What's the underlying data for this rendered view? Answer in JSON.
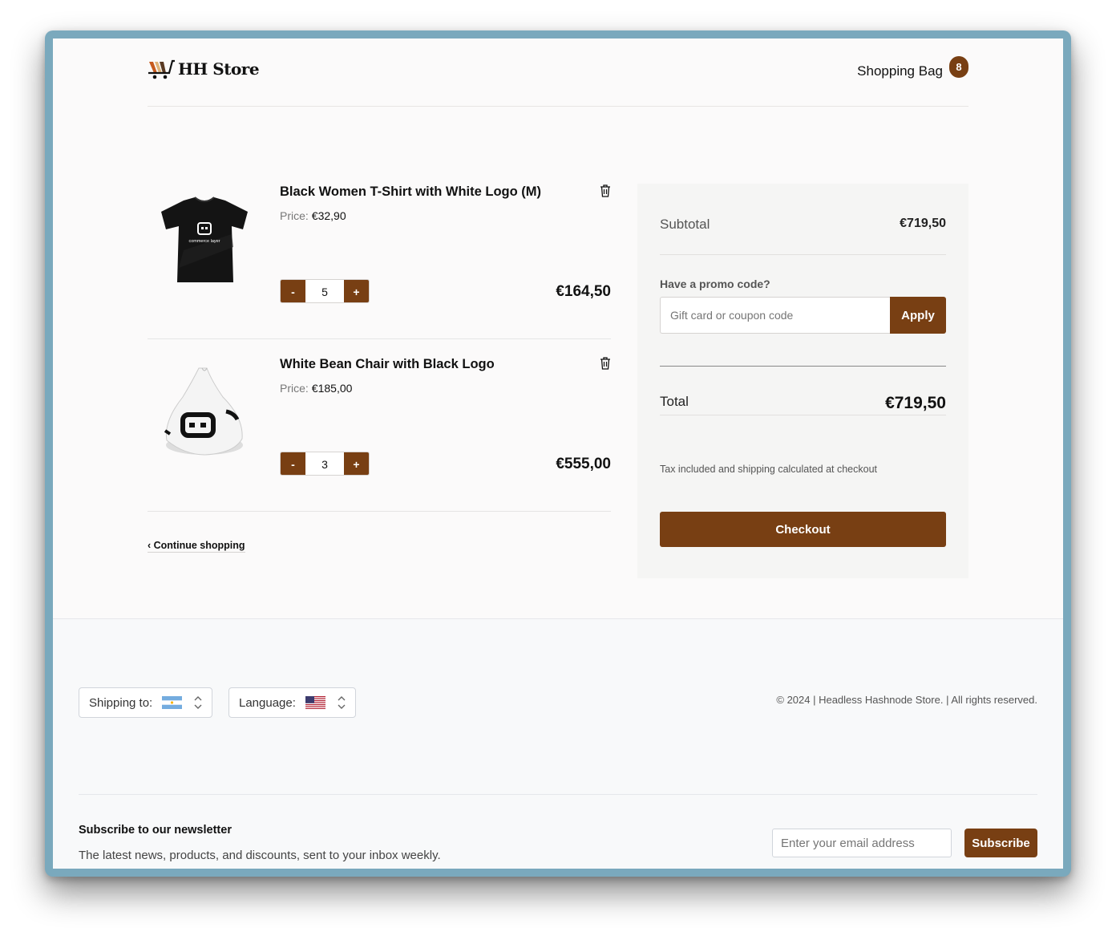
{
  "colors": {
    "accent": "#783f13",
    "frame": "#7aa9bd",
    "background": "#fbfafa"
  },
  "header": {
    "logo_text": "HH Store",
    "bag_label": "Shopping Bag",
    "bag_count": "8"
  },
  "cart": {
    "items": [
      {
        "title": "Black Women T-Shirt with White Logo (M)",
        "price_label": "Price:",
        "price": "€32,90",
        "quantity": "5",
        "total": "€164,50",
        "image_icon": "tshirt-image",
        "image_text": "commerce layer"
      },
      {
        "title": "White Bean Chair with Black Logo",
        "price_label": "Price:",
        "price": "€185,00",
        "quantity": "3",
        "total": "€555,00",
        "image_icon": "bean-chair-image"
      }
    ],
    "minus_label": "-",
    "plus_label": "+",
    "continue_label": "‹ Continue shopping"
  },
  "summary": {
    "subtotal_label": "Subtotal",
    "subtotal_value": "€719,50",
    "promo_label": "Have a promo code?",
    "promo_placeholder": "Gift card or coupon code",
    "apply_label": "Apply",
    "total_label": "Total",
    "total_value": "€719,50",
    "tax_note": "Tax included and shipping calculated at checkout",
    "checkout_label": "Checkout"
  },
  "footer": {
    "shipping_label": "Shipping to:",
    "shipping_flag": "argentina-flag-icon",
    "language_label": "Language:",
    "language_flag": "usa-flag-icon",
    "copyright": "© 2024 | Headless Hashnode Store. | All rights reserved.",
    "newsletter_title": "Subscribe to our newsletter",
    "newsletter_desc": "The latest news, products, and discounts, sent to your inbox weekly.",
    "email_placeholder": "Enter your email address",
    "subscribe_label": "Subscribe"
  }
}
